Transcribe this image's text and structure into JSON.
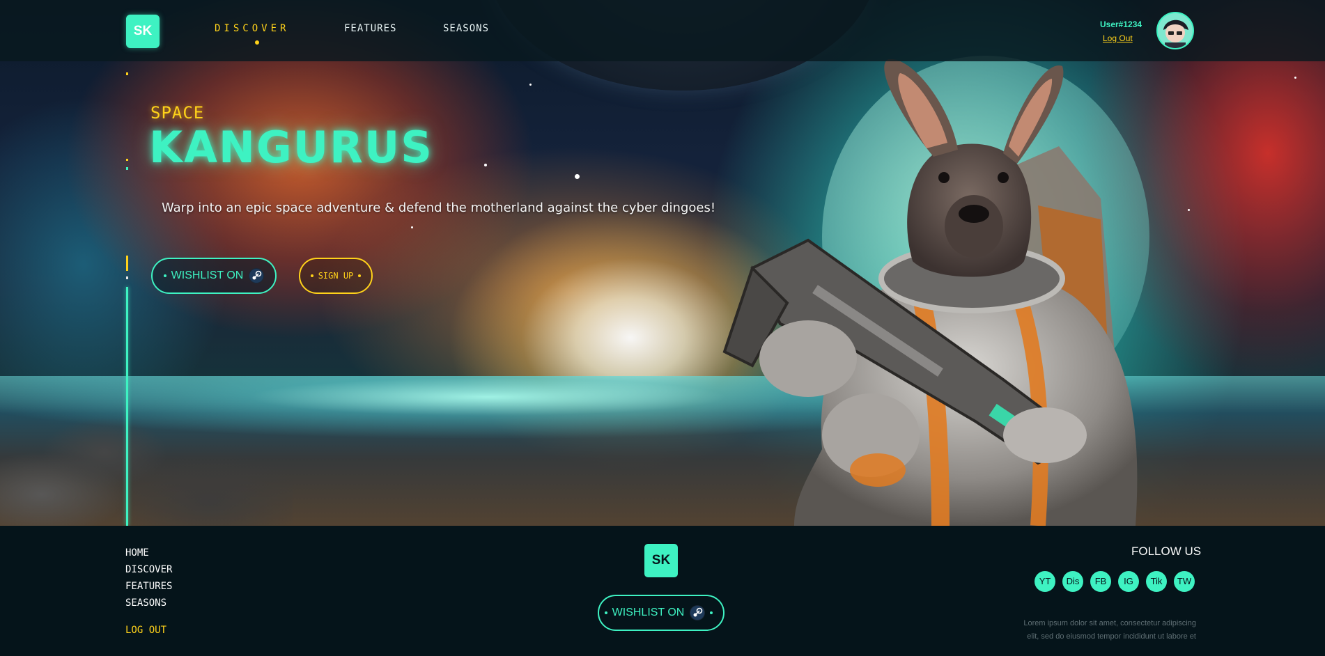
{
  "nav": {
    "logo": "SK",
    "links": [
      "DISCOVER",
      "FEATURES",
      "SEASONS"
    ],
    "active_link": "DISCOVER",
    "user": {
      "name": "User#1234",
      "logout": "Log Out"
    }
  },
  "hero": {
    "pretitle": "SPACE",
    "title": "KANGURUS",
    "tagline": "Warp into an epic space adventure & defend the motherland against the cyber dingoes!",
    "wishlist_label": "WISHLIST ON",
    "signup_label": "SIGN UP"
  },
  "footer": {
    "links": [
      "HOME",
      "DISCOVER",
      "FEATURES",
      "SEASONS"
    ],
    "logout": "LOG OUT",
    "logo": "SK",
    "wishlist_label": "WISHLIST ON",
    "follow_label": "FOLLOW US",
    "social": [
      "YT",
      "Dis",
      "FB",
      "IG",
      "Tik",
      "TW"
    ],
    "lorem_line1": "Lorem ipsum dolor sit amet, consectetur adipiscing",
    "lorem_line2": "elit, sed do eiusmod tempor incididunt ut labore et"
  },
  "colors": {
    "accent": "#3ef2c2",
    "highlight": "#ffd21a",
    "background": "#05141a"
  }
}
